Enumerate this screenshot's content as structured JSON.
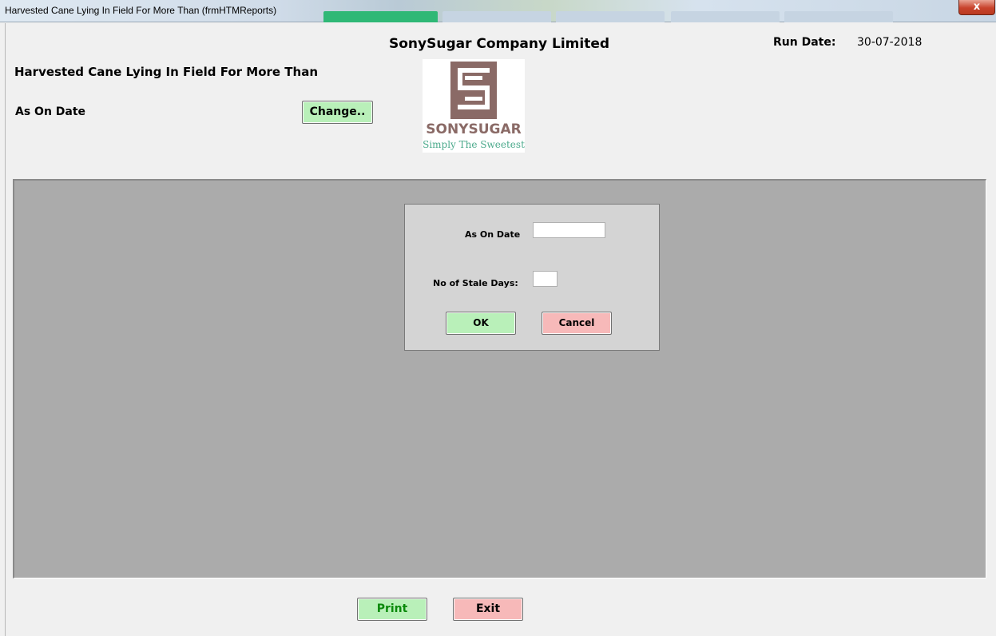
{
  "window": {
    "title": "Harvested Cane Lying In Field For More Than  (frmHTMReports)",
    "close_label": "x"
  },
  "header": {
    "company_name": "SonySugar Company Limited",
    "run_date_label": "Run Date:",
    "run_date_value": "30-07-2018",
    "report_title": "Harvested Cane Lying In Field For More Than",
    "as_on_date_label": "As On Date",
    "change_button": "Change.."
  },
  "logo": {
    "name": "SONYSUGAR",
    "tagline": "Simply The Sweetest",
    "color": "#8a6a66",
    "tagline_color": "#4caa8c"
  },
  "dialog": {
    "as_on_date_label": "As On Date",
    "as_on_date_value": "",
    "stale_days_label": "No of Stale Days:",
    "stale_days_value": "",
    "ok_button": "OK",
    "cancel_button": "Cancel"
  },
  "footer": {
    "print_button": "Print",
    "exit_button": "Exit"
  },
  "colors": {
    "green_button": "#b9f0b9",
    "red_button": "#f7b9b9",
    "panel": "#ababab",
    "dialog": "#d4d4d4"
  }
}
